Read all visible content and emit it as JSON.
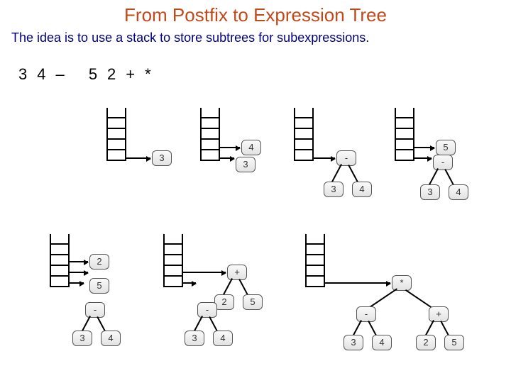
{
  "title": "From Postfix to Expression Tree",
  "subtitle": "The idea is to use a stack to store subtrees for subexpressions.",
  "postfix": "34– 52+*",
  "labels": {
    "n3": "3",
    "n4": "4",
    "n5": "5",
    "n2": "2",
    "minus": "-",
    "plus": "+",
    "star": "*"
  }
}
